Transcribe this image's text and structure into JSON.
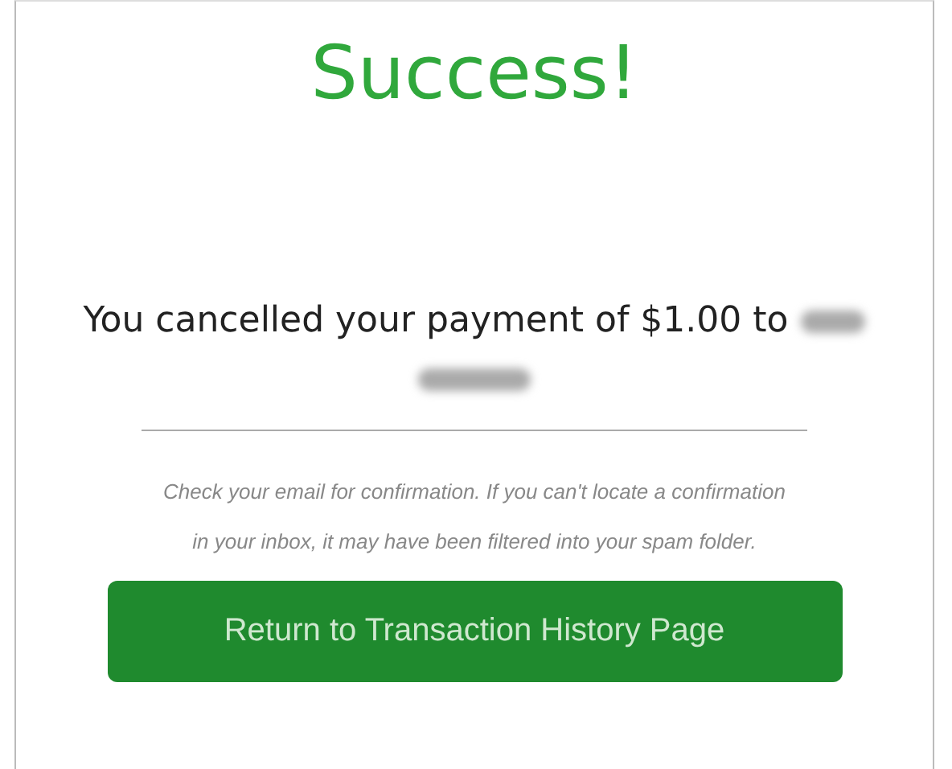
{
  "heading": "Success!",
  "message": "You cancelled your payment of $1.00 to",
  "note": "Check your email for confirmation. If you can't locate a confirmation in your inbox, it may have been filtered into your spam folder.",
  "button": {
    "label": "Return to Transaction History Page"
  }
}
